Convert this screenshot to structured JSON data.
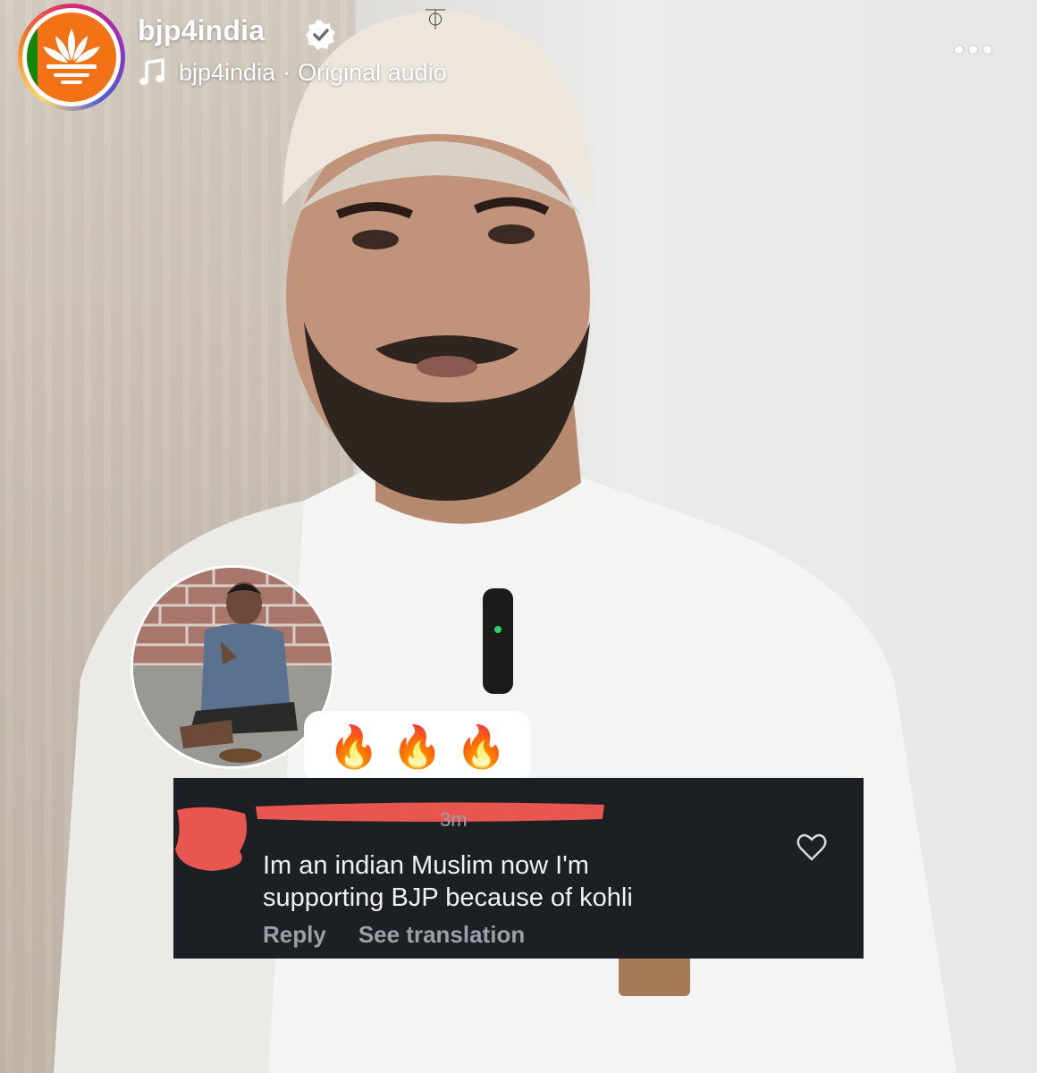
{
  "header": {
    "username": "bjp4india",
    "audio_account": "bjp4india",
    "audio_separator": "·",
    "audio_title": "Original audio",
    "icons": {
      "avatar": "lotus-logo-icon",
      "verified": "verified-badge-icon",
      "music": "music-note-icon",
      "more": "more-options-icon"
    }
  },
  "reaction": {
    "emoji": [
      "🔥",
      "🔥",
      "🔥"
    ]
  },
  "comment": {
    "time": "3m",
    "text_line1": "Im an indian Muslim now I'm",
    "text_line2": "supporting BJP because of kohli",
    "reply_label": "Reply",
    "translate_label": "See translation",
    "icons": {
      "like": "heart-outline-icon"
    }
  },
  "colors": {
    "comment_bg": "#1c1f24",
    "redaction": "#e8574f",
    "brand_orange": "#f47216",
    "brand_green": "#138808"
  }
}
